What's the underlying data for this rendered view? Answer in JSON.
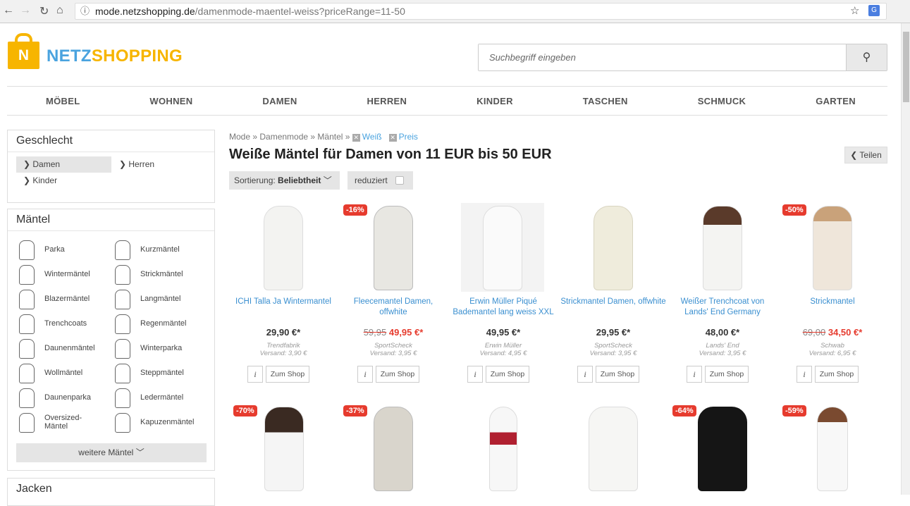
{
  "browser": {
    "url_host": "mode.netzshopping.de",
    "url_path": "/damenmode-maentel-weiss?priceRange=11-50"
  },
  "logo": {
    "bag_letter": "N",
    "part1": "NETZ",
    "part2": "SHOPPING"
  },
  "search": {
    "placeholder": "Suchbegriff eingeben"
  },
  "nav": [
    "MÖBEL",
    "WOHNEN",
    "DAMEN",
    "HERREN",
    "KINDER",
    "TASCHEN",
    "SCHMUCK",
    "GARTEN"
  ],
  "sidebar": {
    "gender_title": "Geschlecht",
    "genders": [
      "Damen",
      "Herren",
      "Kinder"
    ],
    "coats_title": "Mäntel",
    "coats": [
      "Parka",
      "Kurzmäntel",
      "Wintermäntel",
      "Strickmäntel",
      "Blazermäntel",
      "Langmäntel",
      "Trenchcoats",
      "Regenmäntel",
      "Daunenmäntel",
      "Winterparka",
      "Wollmäntel",
      "Steppmäntel",
      "Daunenparka",
      "Ledermäntel",
      "Oversized-Mäntel",
      "Kapuzenmäntel"
    ],
    "more_label": "weitere Mäntel",
    "jackets_title": "Jacken"
  },
  "breadcrumb": {
    "mode": "Mode",
    "damenmode": "Damenmode",
    "maentel": "Mäntel",
    "weiss": "Weiß",
    "preis": "Preis"
  },
  "title": "Weiße Mäntel für Damen von 11 EUR bis 50 EUR",
  "share_label": "Teilen",
  "sort": {
    "prefix": "Sortierung:",
    "value": "Beliebtheit"
  },
  "reduced_label": "reduziert",
  "products": [
    {
      "name": "ICHI Talla Ja Wintermantel",
      "price": "29,90 €*",
      "shop": "Trendfabrik",
      "shipping": "Versand: 3,90 €",
      "badge": ""
    },
    {
      "name": "Fleecemantel Damen, offwhite",
      "old_price": "59,95",
      "price": "49,95 €*",
      "shop": "SportScheck",
      "shipping": "Versand: 3,95 €",
      "badge": "-16%"
    },
    {
      "name": "Erwin Müller Piqué Bademantel lang weiss XXL",
      "price": "49,95 €*",
      "shop": "Erwin Müller",
      "shipping": "Versand: 4,95 €",
      "badge": ""
    },
    {
      "name": "Strickmantel Damen, offwhite",
      "price": "29,95 €*",
      "shop": "SportScheck",
      "shipping": "Versand: 3,95 €",
      "badge": ""
    },
    {
      "name": "Weißer Trenchcoat von Lands' End Germany",
      "price": "48,00 €*",
      "shop": "Lands' End",
      "shipping": "Versand: 3,95 €",
      "badge": ""
    },
    {
      "name": "Strickmantel",
      "old_price": "69,00",
      "price": "34,50 €*",
      "shop": "Schwab",
      "shipping": "Versand: 6,95 €",
      "badge": "-50%"
    }
  ],
  "second_row_badges": [
    "-70%",
    "-37%",
    "",
    "",
    "-64%",
    "-59%"
  ],
  "button_info": "i",
  "button_shop": "Zum Shop"
}
